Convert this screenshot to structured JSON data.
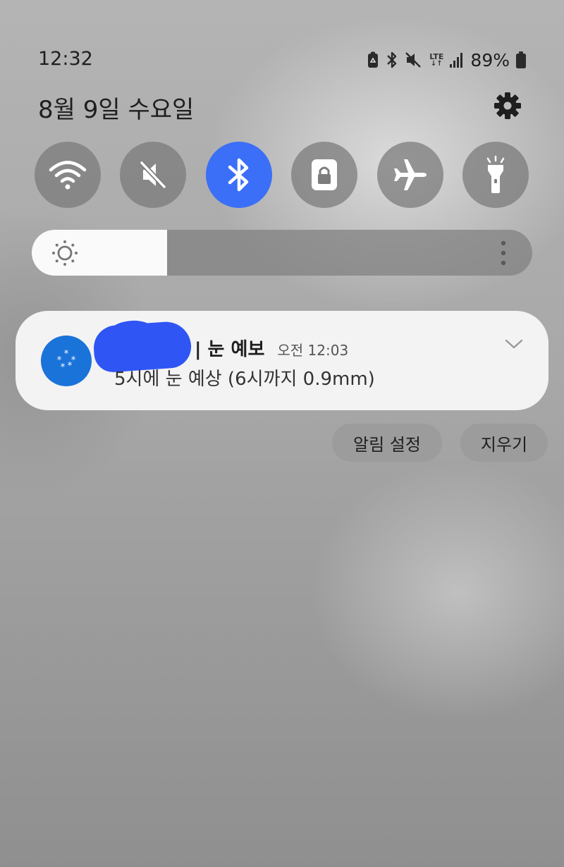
{
  "status_bar": {
    "time": "12:32",
    "battery_percent": "89%",
    "network_label": "LTE",
    "network_arrows": "↓↑",
    "icons": [
      "battery-saver-icon",
      "bluetooth-icon",
      "mute-icon",
      "lte-icon",
      "signal-icon",
      "battery-icon"
    ]
  },
  "header": {
    "date": "8월 9일 수요일",
    "settings_icon": "gear-icon"
  },
  "quick_toggles": [
    {
      "icon": "wifi-icon",
      "active": false
    },
    {
      "icon": "mute-icon",
      "active": false
    },
    {
      "icon": "bluetooth-icon",
      "active": true
    },
    {
      "icon": "lock-icon",
      "active": false
    },
    {
      "icon": "airplane-icon",
      "active": false
    },
    {
      "icon": "flashlight-icon",
      "active": false
    }
  ],
  "brightness": {
    "level": 0.27,
    "icon": "sun-icon"
  },
  "notification": {
    "app_icon": "snow-icon",
    "title": "| 눈 예보",
    "time": "오전 12:03",
    "body": "5시에 눈 예상 (6시까지 0.9mm)"
  },
  "actions": {
    "notification_settings": "알림 설정",
    "clear": "지우기"
  },
  "colors": {
    "accent": "#3b6ff7",
    "app_icon_bg": "#1a73d9",
    "redaction": "#2f55f5"
  }
}
